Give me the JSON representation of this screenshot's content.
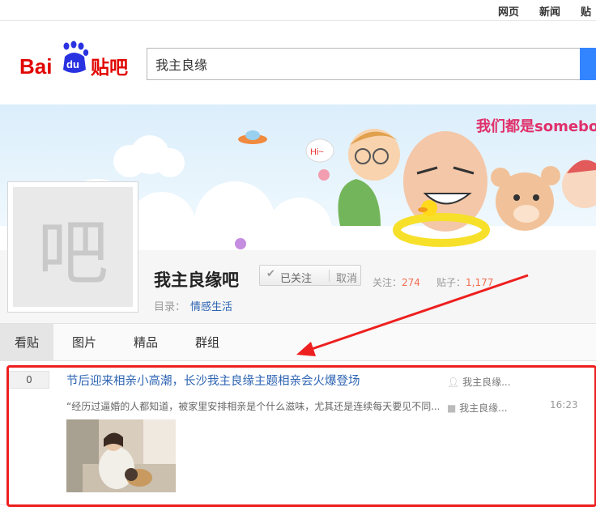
{
  "topnav": {
    "items": [
      "网页",
      "新闻",
      "贴吧"
    ]
  },
  "logo": {
    "text_bai": "Bai",
    "text_du": "du",
    "text_tieba": "贴吧"
  },
  "search": {
    "value": "我主良缘"
  },
  "banner": {
    "slogan": "我们都是somebody"
  },
  "forum": {
    "avatar_char": "吧",
    "name": "我主良缘吧",
    "follow_label": "已关注",
    "cancel_label": "取消",
    "follow_count_label": "关注：",
    "follow_count": "274",
    "post_count_label": "贴子：",
    "post_count": "1,177",
    "category_label": "目录：",
    "category": "情感生活"
  },
  "tabs": [
    {
      "label": "看贴"
    },
    {
      "label": "图片"
    },
    {
      "label": "精品"
    },
    {
      "label": "群组"
    }
  ],
  "thread": {
    "reply_count": "0",
    "title": "节后迎来相亲小高潮，长沙我主良缘主题相亲会火爆登场",
    "excerpt": "“经历过逼婚的人都知道，被家里安排相亲是个什么滋味，尤其还是连续每天要见不同...",
    "author": "我主良缘...",
    "last_reply_author": "我主良缘...",
    "time": "16:23"
  },
  "colors": {
    "link": "#2d64b3",
    "accent_red": "#ee1f1f",
    "count_orange": "#f26c4f",
    "search_blue": "#3385ff"
  }
}
